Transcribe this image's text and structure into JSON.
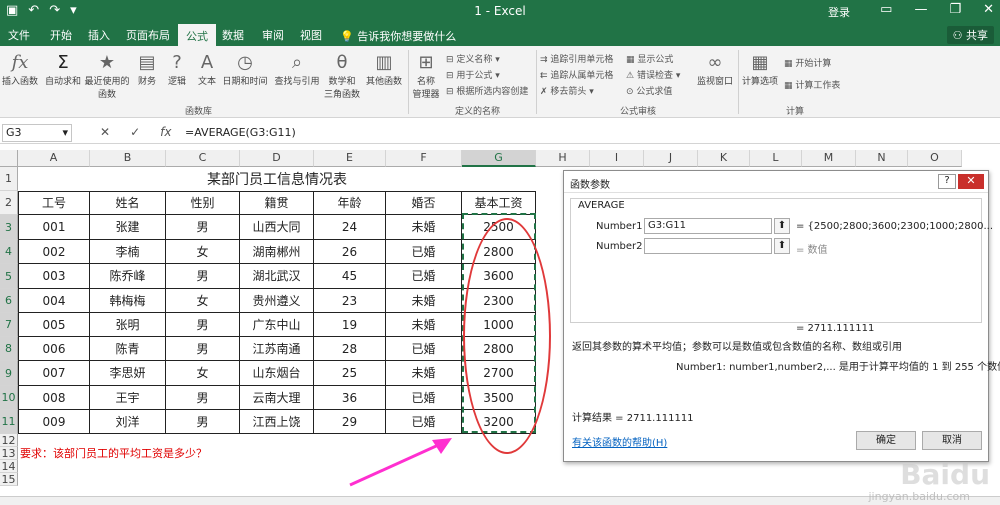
{
  "window": {
    "title": "1 - Excel",
    "login": "登录",
    "qa_icons": [
      "save-icon",
      "undo-icon",
      "redo-icon",
      "customize-icon"
    ]
  },
  "tabs": {
    "items": [
      "文件",
      "开始",
      "插入",
      "页面布局",
      "公式",
      "数据",
      "审阅",
      "视图"
    ],
    "active": "公式",
    "tellme": "告诉我你想要做什么",
    "share": "共享"
  },
  "ribbon": {
    "insert_function": "插入函数",
    "autosum": "自动求和",
    "recent": "最近使用的\n函数",
    "financial": "财务",
    "logical": "逻辑",
    "text": "文本",
    "datetime": "日期和时间",
    "lookup": "查找与引用",
    "math": "数学和\n三角函数",
    "more": "其他函数",
    "group_library": "函数库",
    "name_manager": "名称\n管理器",
    "define_name": "定义名称",
    "use_in_formula": "用于公式",
    "create_from_sel": "根据所选内容创建",
    "group_names": "定义的名称",
    "trace_prec": "追踪引用单元格",
    "trace_dep": "追踪从属单元格",
    "remove_arrows": "移去箭头",
    "show_formulas": "显示公式",
    "error_check": "错误检查",
    "evaluate": "公式求值",
    "group_audit": "公式审核",
    "watch": "监视窗口",
    "calc_options": "计算选项",
    "calc_now": "开始计算",
    "calc_sheet": "计算工作表",
    "group_calc": "计算"
  },
  "formula_bar": {
    "name_box": "G3",
    "formula": "=AVERAGE(G3:G11)"
  },
  "columns": [
    "A",
    "B",
    "C",
    "D",
    "E",
    "F",
    "G",
    "H",
    "I",
    "J",
    "K",
    "L",
    "M",
    "N",
    "O"
  ],
  "rows": [
    "1",
    "2",
    "3",
    "4",
    "5",
    "6",
    "7",
    "8",
    "9",
    "10",
    "11",
    "12",
    "13",
    "14",
    "15"
  ],
  "table": {
    "title": "某部门员工信息情况表",
    "headers": [
      "工号",
      "姓名",
      "性别",
      "籍贯",
      "年龄",
      "婚否",
      "基本工资"
    ],
    "rows": [
      [
        "001",
        "张建",
        "男",
        "山西大同",
        "24",
        "未婚",
        "2500"
      ],
      [
        "002",
        "李楠",
        "女",
        "湖南郴州",
        "26",
        "已婚",
        "2800"
      ],
      [
        "003",
        "陈乔峰",
        "男",
        "湖北武汉",
        "45",
        "已婚",
        "3600"
      ],
      [
        "004",
        "韩梅梅",
        "女",
        "贵州遵义",
        "23",
        "未婚",
        "2300"
      ],
      [
        "005",
        "张明",
        "男",
        "广东中山",
        "19",
        "未婚",
        "1000"
      ],
      [
        "006",
        "陈青",
        "男",
        "江苏南通",
        "28",
        "已婚",
        "2800"
      ],
      [
        "007",
        "李思妍",
        "女",
        "山东烟台",
        "25",
        "未婚",
        "2700"
      ],
      [
        "008",
        "王宇",
        "男",
        "云南大理",
        "36",
        "已婚",
        "3500"
      ],
      [
        "009",
        "刘洋",
        "男",
        "江西上饶",
        "29",
        "已婚",
        "3200"
      ]
    ]
  },
  "requirement": "要求：该部门员工的平均工资是多少？",
  "dialog": {
    "title": "函数参数",
    "help": "?",
    "close": "✕",
    "function": "AVERAGE",
    "arg1_label": "Number1",
    "arg1_value": "G3:G11",
    "arg1_result": "= {2500;2800;3600;2300;1000;2800...",
    "arg2_label": "Number2",
    "arg2_result": "= 数值",
    "result_line": "=  2711.111111",
    "description": "返回其参数的算术平均值；参数可以是数值或包含数值的名称、数组或引用",
    "arg_help": "Number1:  number1,number2,... 是用于计算平均值的 1 到 255 个数值参数",
    "calc_result": "计算结果 =   2711.111111",
    "help_link": "有关该函数的帮助(H)",
    "ok": "确定",
    "cancel": "取消"
  },
  "watermark": "Baidu",
  "watermark_url": "jingyan.baidu.com"
}
